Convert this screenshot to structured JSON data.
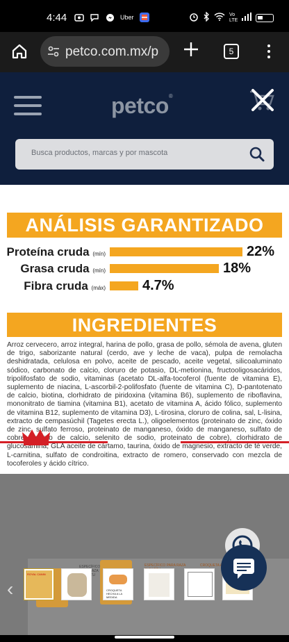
{
  "status_bar": {
    "time": "4:44",
    "app_icons": [
      "camera-icon",
      "chat-icon",
      "messenger-icon",
      "uber-icon",
      "app-icon"
    ],
    "uber_label": "Uber",
    "right_icons": [
      "alarm-icon",
      "bluetooth-icon",
      "wifi-icon",
      "signal-icon",
      "battery-icon"
    ],
    "volte_label": "Vo LTE"
  },
  "browser": {
    "url": "petco.com.mx/p",
    "tab_count": "5"
  },
  "site": {
    "logo": "petco",
    "search_placeholder": "Busca productos, marcas y por mascota"
  },
  "analysis": {
    "title": "ANÁLISIS GARANTIZADO",
    "rows": [
      {
        "label": "Proteína cruda",
        "qualifier": "(mín)",
        "value": "22%",
        "fraction": 0.22
      },
      {
        "label": "Grasa cruda",
        "qualifier": "(mín)",
        "value": "18%",
        "fraction": 0.18
      },
      {
        "label": "Fibra cruda",
        "qualifier": "(máx)",
        "value": "4.7%",
        "fraction": 0.047
      }
    ]
  },
  "ingredients": {
    "title": "INGREDIENTES",
    "text": "Arroz cervecero, arroz integral, harina de pollo, grasa de pollo, sémola de avena, gluten de trigo, saborizante natural (cerdo, ave y leche de vaca), pulpa de remolacha deshidratada, celulosa en polvo, aceite de pescado, aceite vegetal, silicoaluminato sódico, carbonato de calcio, cloruro de potasio, DL-metionina, fructooligosacáridos, tripolifosfato de sodio, vitaminas (acetato DL-alfa-tocoferol (fuente de vitamina E), suplemento de niacina, L-ascorbil-2-polifosfato (fuente de vitamina C), D-pantotenato de calcio, biotina, clorhidrato de piridoxina (vitamina B6), suplemento de riboflavina, mononitrato de tiamina (vitamina B1), acetato de vitamina A, ácido fólico, suplemento de vitamina B12, suplemento de vitamina D3), L-tirosina, cloruro de colina, sal, L-lisina, extracto de cempasúchil (Tagetes erecta L.), oligoelementos (proteinato de zinc, óxido de zinc, sulfato ferroso, proteinato de manganeso, óxido de manganeso, sulfato de cobre, yodato de calcio, selenito de sodio, proteinato de cobre), clorhidrato de glucosamina, GLA aceite de cártamo, taurina, óxido de magnesio, extracto de té verde, L-carnitina, sulfato de condroitina, extracto de romero, conservado con mezcla de tocoferoles y ácido cítrico."
  },
  "gallery": {
    "brand": "ROYAL CANIN",
    "thumb_labels": [
      "ROYAL CANIN",
      "",
      "CROQUETA HECHA A LA MEDIDA",
      "",
      "",
      ""
    ],
    "specific_label": "ESPECÍFICO PARA RAZA SHIH TZU",
    "kibble_label": "CROQUETA ADAPTADA",
    "thumb_count": 7
  },
  "colors": {
    "accent": "#f4a620",
    "header": "#0f1f3d",
    "brand_red": "#d41f26"
  }
}
